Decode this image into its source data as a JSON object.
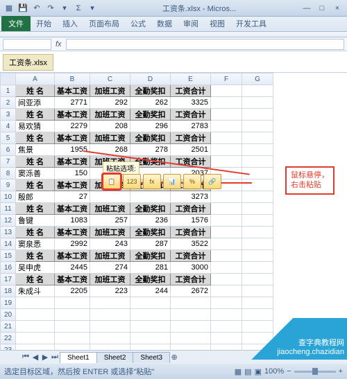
{
  "window": {
    "title": "工资条.xlsx - Micros...",
    "min": "—",
    "max": "□",
    "close": "×",
    "help": "?"
  },
  "ribbon": {
    "file": "文件",
    "tabs": [
      "开始",
      "插入",
      "页面布局",
      "公式",
      "数据",
      "审阅",
      "视图",
      "开发工具"
    ]
  },
  "formula": {
    "fx": "fx"
  },
  "workbook_tab": "工资条.xlsx",
  "cols": [
    "A",
    "B",
    "C",
    "D",
    "E",
    "F",
    "G"
  ],
  "headers": {
    "name": "姓 名",
    "base": "基本工资",
    "ot": "加班工资",
    "bonus": "全勤奖扣",
    "total": "工资合计"
  },
  "rows": [
    {
      "r": 1,
      "type": "h"
    },
    {
      "r": 2,
      "type": "d",
      "name": "间亚添",
      "b": 2771,
      "c": 292,
      "d": 262,
      "e": 3325
    },
    {
      "r": 3,
      "type": "h"
    },
    {
      "r": 4,
      "type": "d",
      "name": "易欢猜",
      "b": 2279,
      "c": 208,
      "d": 296,
      "e": 2783
    },
    {
      "r": 5,
      "type": "h"
    },
    {
      "r": 6,
      "type": "d",
      "name": "焦景",
      "b": 1955,
      "c": 268,
      "d": 278,
      "e": 2501
    },
    {
      "r": 7,
      "type": "h"
    },
    {
      "r": 8,
      "type": "d",
      "name": "窦泺善",
      "b": 150,
      "c": "",
      "d": "",
      "e": 2037
    },
    {
      "r": 9,
      "type": "h"
    },
    {
      "r": 10,
      "type": "d",
      "name": "殷郎",
      "b": 27,
      "c": "",
      "d": "",
      "e": 3273
    },
    {
      "r": 11,
      "type": "h"
    },
    {
      "r": 12,
      "type": "d",
      "name": "鲁键",
      "b": 1083,
      "c": 257,
      "d": 236,
      "e": 1576
    },
    {
      "r": 13,
      "type": "h"
    },
    {
      "r": 14,
      "type": "d",
      "name": "窦泉悉",
      "b": 2992,
      "c": 243,
      "d": 287,
      "e": 3522
    },
    {
      "r": 15,
      "type": "h"
    },
    {
      "r": 16,
      "type": "d",
      "name": "吴申虎",
      "b": 2445,
      "c": 274,
      "d": 281,
      "e": 3000
    },
    {
      "r": 17,
      "type": "h"
    },
    {
      "r": 18,
      "type": "d",
      "name": "朱成斗",
      "b": 2205,
      "c": 223,
      "d": 244,
      "e": 2672
    }
  ],
  "paste": {
    "label": "粘贴选项:",
    "opts": [
      "📋",
      "123",
      "fx",
      "📊",
      "%",
      "🔗"
    ]
  },
  "callout": {
    "l1": "鼠标悬停，",
    "l2": "右击粘贴"
  },
  "sheets": [
    "Sheet1",
    "Sheet2",
    "Sheet3"
  ],
  "status": {
    "text": "选定目标区域，然后按 ENTER 或选择\"粘贴\"",
    "zoom": "100%"
  },
  "watermark": {
    "l1": "查字典教程网",
    "l2": "jiaocheng.chazidian"
  }
}
